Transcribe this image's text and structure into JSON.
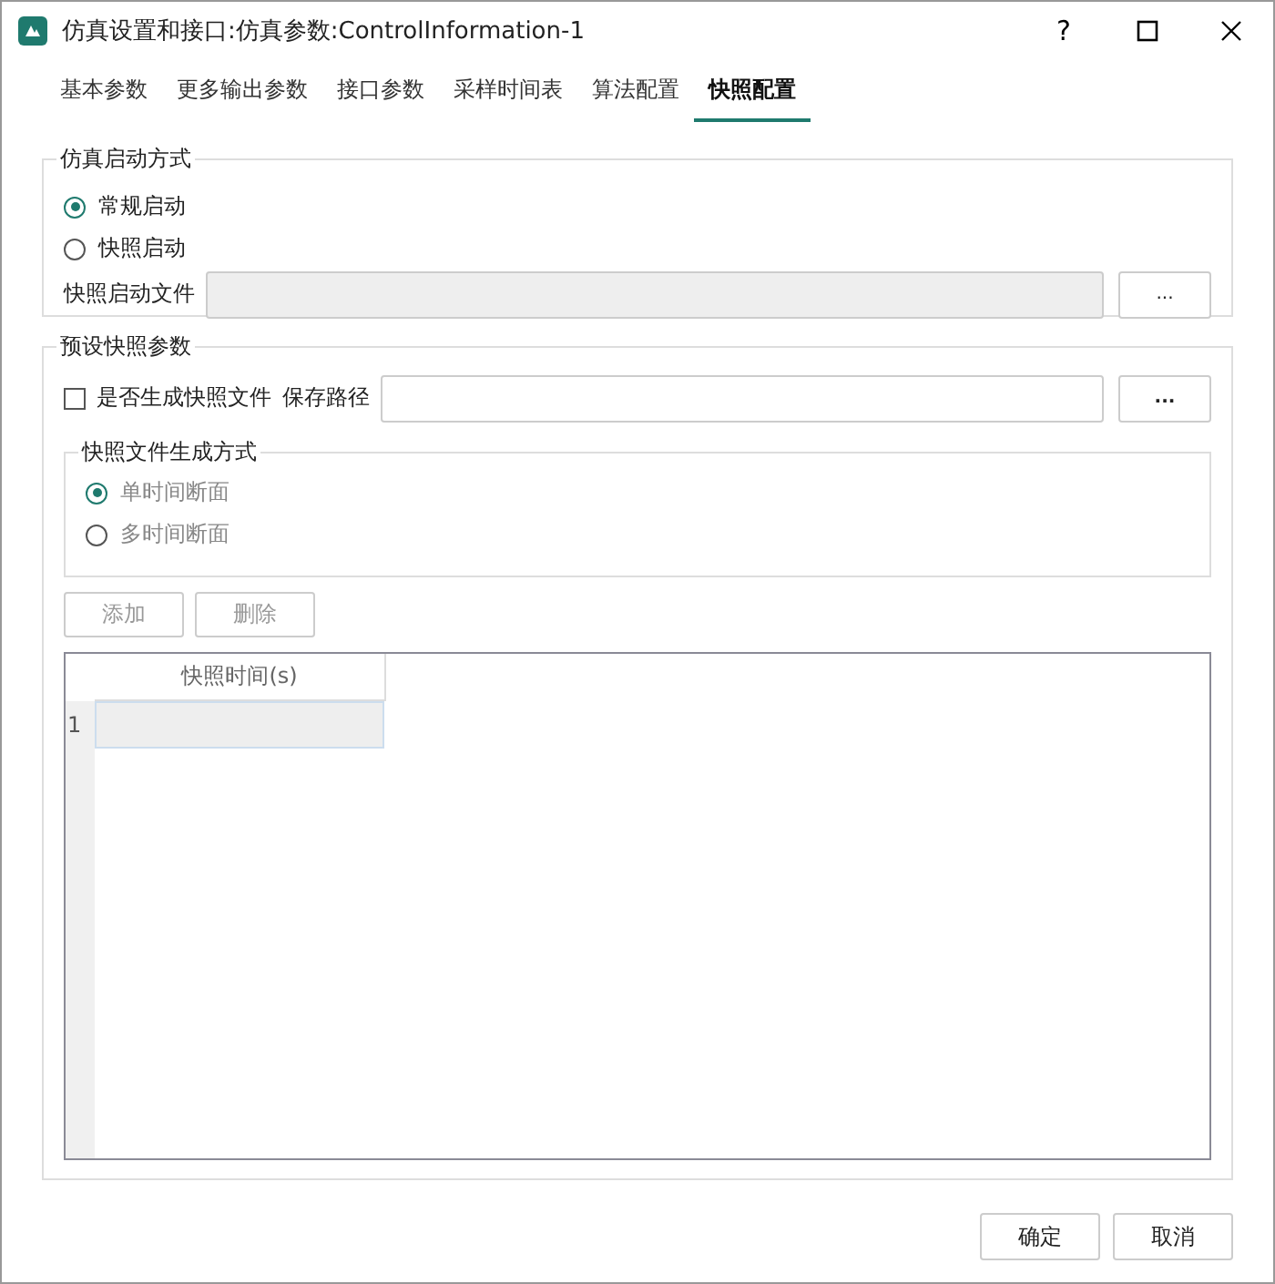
{
  "window": {
    "title": "仿真设置和接口:仿真参数:ControlInformation-1",
    "help": "?"
  },
  "tabs": [
    {
      "label": "基本参数",
      "selected": false
    },
    {
      "label": "更多输出参数",
      "selected": false
    },
    {
      "label": "接口参数",
      "selected": false
    },
    {
      "label": "采样时间表",
      "selected": false
    },
    {
      "label": "算法配置",
      "selected": false
    },
    {
      "label": "快照配置",
      "selected": true
    }
  ],
  "startup_group": {
    "title": "仿真启动方式",
    "options": [
      {
        "label": "常规启动",
        "selected": true
      },
      {
        "label": "快照启动",
        "selected": false
      }
    ],
    "file_label": "快照启动文件",
    "file_disabled": true,
    "browse_button": "..."
  },
  "snapshot_group": {
    "title": "预设快照参数",
    "generate": {
      "label": "是否生成快照文件",
      "checked": false
    },
    "save_path_label": "保存路径",
    "browse_button": "...",
    "method_group": {
      "title": "快照文件生成方式",
      "disabled": true,
      "options": [
        {
          "label": "单时间断面",
          "selected": true
        },
        {
          "label": "多时间断面",
          "selected": false
        }
      ]
    },
    "buttons": [
      {
        "label": "添加",
        "disabled": true
      },
      {
        "label": "删除",
        "disabled": true
      }
    ],
    "table": {
      "columns": [
        "快照时间(s)"
      ],
      "rows": [
        {
          "number": "1"
        }
      ]
    }
  },
  "footer_buttons": [
    "确定",
    "取消"
  ]
}
